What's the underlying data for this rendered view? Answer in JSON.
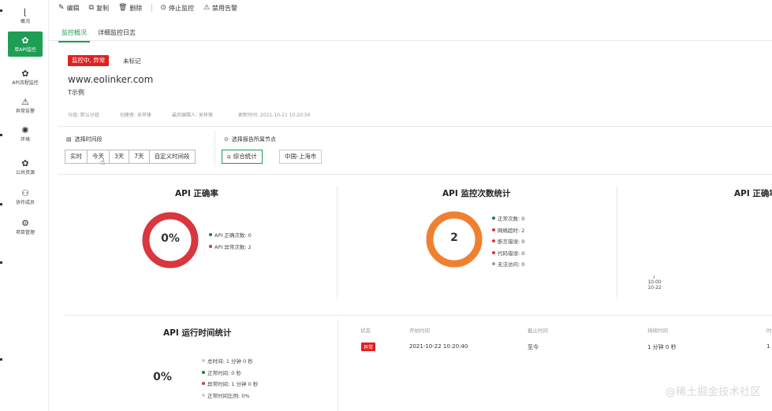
{
  "nav": {
    "items": [
      {
        "label": "概况",
        "icon": "chart-icon"
      },
      {
        "label": "单API监控",
        "icon": "monitor-icon"
      },
      {
        "label": "API流程监控",
        "icon": "flow-icon"
      },
      {
        "label": "异常告警",
        "icon": "warning-icon"
      },
      {
        "label": "环境",
        "icon": "environment-icon"
      },
      {
        "label": "公共资源",
        "icon": "resource-icon"
      },
      {
        "label": "协作成员",
        "icon": "members-icon"
      },
      {
        "label": "项目管理",
        "icon": "settings-icon"
      }
    ]
  },
  "toolbar": {
    "edit": "编辑",
    "copy": "复制",
    "delete": "删除",
    "stop": "停止监控",
    "disable_alert": "禁用告警"
  },
  "tabs": [
    "监控概况",
    "详细监控日志"
  ],
  "header": {
    "status_badge": "监控中, 异常",
    "mark": "未标记",
    "url": "www.eolinker.com",
    "name": "T示例",
    "group": "分组: 默认分组",
    "creator": "创建者: 吴梓锋",
    "editor": "最后编辑人: 吴梓锋",
    "updated": "更新时间: 2021-10-21 10:20:56"
  },
  "filters": {
    "time_label": "选择时间段",
    "time_options": [
      "实时",
      "今天",
      "3天",
      "7天",
      "自定义时间段"
    ],
    "node_label": "选择报告所属节点",
    "node_options": [
      "综合统计",
      "中国-上海市"
    ]
  },
  "cards": {
    "accuracy": {
      "title": "API 正确率",
      "center": "0%",
      "legend": [
        {
          "label": "API 正确次数: 0",
          "color": "#1e7e45"
        },
        {
          "label": "API 异常次数: 2",
          "color": "#d9363e"
        }
      ]
    },
    "count": {
      "title": "API 监控次数统计",
      "center": "2",
      "legend": [
        {
          "label": "正常次数: 0",
          "color": "#1e7e45"
        },
        {
          "label": "网络超时: 2",
          "color": "#d9363e"
        },
        {
          "label": "断言错误: 0",
          "color": "#d9363e"
        },
        {
          "label": "代码错误: 0",
          "color": "#d9363e"
        },
        {
          "label": "无法访问: 0",
          "color": "#999999"
        }
      ]
    },
    "accuracy_trend": {
      "title": "API 正确率",
      "tick_time": "10:00",
      "tick_date": "10-22"
    },
    "runtime": {
      "title": "API 运行时间统计",
      "center": "0%",
      "legend": [
        {
          "label": "总时间: 1 分钟 0 秒",
          "color": "#cccccc"
        },
        {
          "label": "正常时间: 0 秒",
          "color": "#1e7e45"
        },
        {
          "label": "异常时间: 1 分钟 0 秒",
          "color": "#d9363e"
        },
        {
          "label": "正常时间比例: 0%",
          "color": "#cccccc"
        }
      ]
    }
  },
  "table": {
    "headers": [
      "状态",
      "开始时间",
      "截止时间",
      "持续时间",
      "时"
    ],
    "row": {
      "status": "异常",
      "start": "2021-10-22 10:20:40",
      "end": "至今",
      "duration": "1 分钟 0 秒",
      "extra": "1"
    }
  },
  "watermark": "@稀土掘金技术社区"
}
